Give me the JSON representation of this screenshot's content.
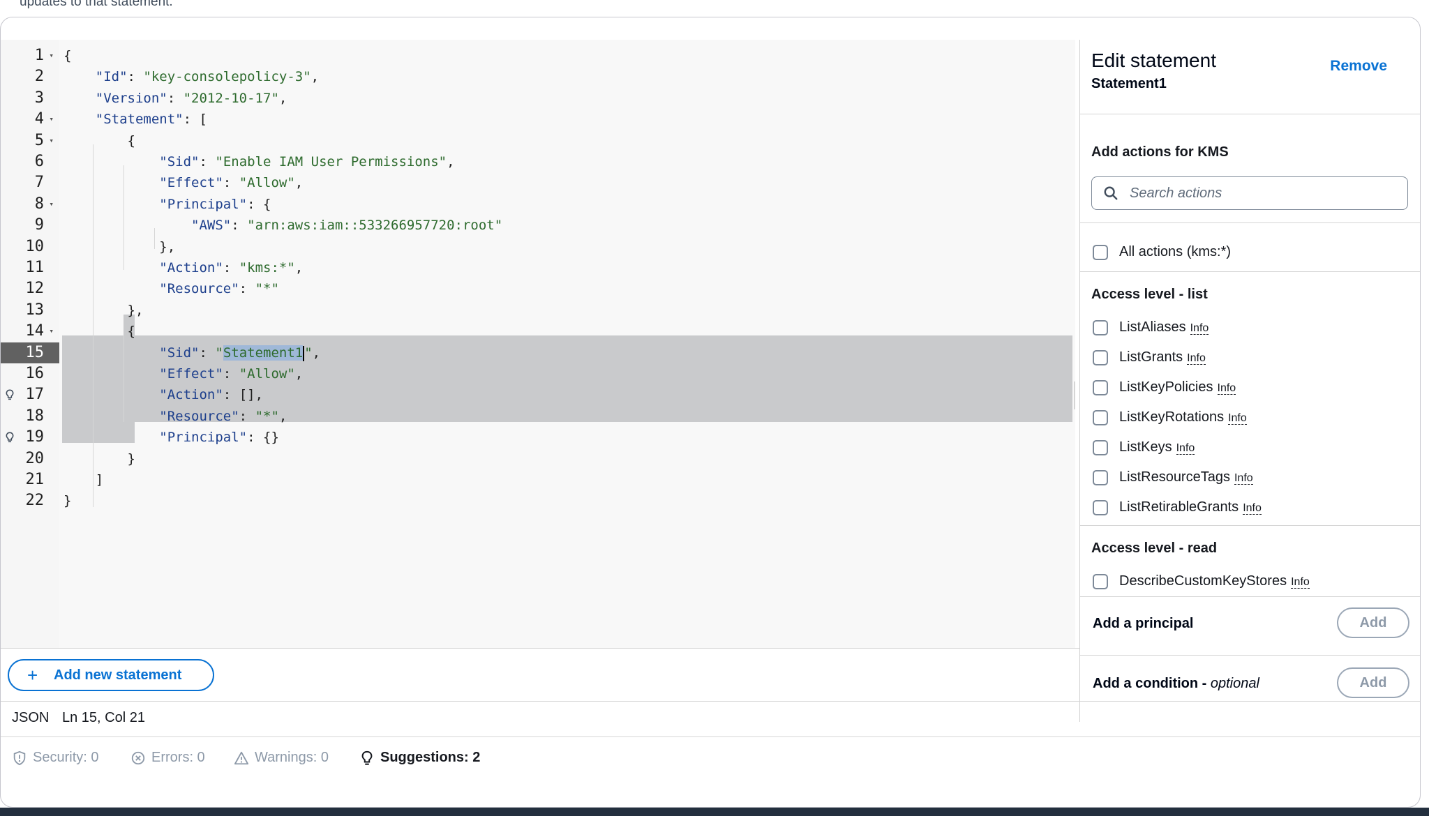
{
  "top_text": "updates to that statement.",
  "editor": {
    "lines": [
      {
        "n": "1",
        "fold": true,
        "parts": [
          {
            "t": "{",
            "c": "p"
          }
        ]
      },
      {
        "n": "2",
        "parts": [
          {
            "t": "    ",
            "c": "p"
          },
          {
            "t": "\"Id\"",
            "c": "k"
          },
          {
            "t": ": ",
            "c": "p"
          },
          {
            "t": "\"key-consolepolicy-3\"",
            "c": "s"
          },
          {
            "t": ",",
            "c": "p"
          }
        ]
      },
      {
        "n": "3",
        "parts": [
          {
            "t": "    ",
            "c": "p"
          },
          {
            "t": "\"Version\"",
            "c": "k"
          },
          {
            "t": ": ",
            "c": "p"
          },
          {
            "t": "\"2012-10-17\"",
            "c": "s"
          },
          {
            "t": ",",
            "c": "p"
          }
        ]
      },
      {
        "n": "4",
        "fold": true,
        "parts": [
          {
            "t": "    ",
            "c": "p"
          },
          {
            "t": "\"Statement\"",
            "c": "k"
          },
          {
            "t": ": [",
            "c": "p"
          }
        ]
      },
      {
        "n": "5",
        "fold": true,
        "parts": [
          {
            "t": "        {",
            "c": "p"
          }
        ]
      },
      {
        "n": "6",
        "parts": [
          {
            "t": "            ",
            "c": "p"
          },
          {
            "t": "\"Sid\"",
            "c": "k"
          },
          {
            "t": ": ",
            "c": "p"
          },
          {
            "t": "\"Enable IAM User Permissions\"",
            "c": "s"
          },
          {
            "t": ",",
            "c": "p"
          }
        ]
      },
      {
        "n": "7",
        "parts": [
          {
            "t": "            ",
            "c": "p"
          },
          {
            "t": "\"Effect\"",
            "c": "k"
          },
          {
            "t": ": ",
            "c": "p"
          },
          {
            "t": "\"Allow\"",
            "c": "s"
          },
          {
            "t": ",",
            "c": "p"
          }
        ]
      },
      {
        "n": "8",
        "fold": true,
        "parts": [
          {
            "t": "            ",
            "c": "p"
          },
          {
            "t": "\"Principal\"",
            "c": "k"
          },
          {
            "t": ": {",
            "c": "p"
          }
        ]
      },
      {
        "n": "9",
        "parts": [
          {
            "t": "                ",
            "c": "p"
          },
          {
            "t": "\"AWS\"",
            "c": "k"
          },
          {
            "t": ": ",
            "c": "p"
          },
          {
            "t": "\"arn:aws:iam::533266957720:root\"",
            "c": "s"
          }
        ]
      },
      {
        "n": "10",
        "parts": [
          {
            "t": "            },",
            "c": "p"
          }
        ]
      },
      {
        "n": "11",
        "parts": [
          {
            "t": "            ",
            "c": "p"
          },
          {
            "t": "\"Action\"",
            "c": "k"
          },
          {
            "t": ": ",
            "c": "p"
          },
          {
            "t": "\"kms:*\"",
            "c": "s"
          },
          {
            "t": ",",
            "c": "p"
          }
        ]
      },
      {
        "n": "12",
        "parts": [
          {
            "t": "            ",
            "c": "p"
          },
          {
            "t": "\"Resource\"",
            "c": "k"
          },
          {
            "t": ": ",
            "c": "p"
          },
          {
            "t": "\"*\"",
            "c": "s"
          }
        ]
      },
      {
        "n": "13",
        "parts": [
          {
            "t": "        },",
            "c": "p"
          }
        ]
      },
      {
        "n": "14",
        "fold": true,
        "parts": [
          {
            "t": "        {",
            "c": "p"
          }
        ]
      },
      {
        "n": "15",
        "active": true,
        "parts": [
          {
            "t": "            ",
            "c": "p"
          },
          {
            "t": "\"Sid\"",
            "c": "k"
          },
          {
            "t": ": ",
            "c": "p"
          },
          {
            "t": "\"",
            "c": "s"
          },
          {
            "t": "Statement1",
            "c": "s",
            "sel": true
          },
          {
            "t": "\"",
            "c": "s",
            "caret": true
          },
          {
            "t": ",",
            "c": "p"
          }
        ]
      },
      {
        "n": "16",
        "parts": [
          {
            "t": "            ",
            "c": "p"
          },
          {
            "t": "\"Effect\"",
            "c": "k"
          },
          {
            "t": ": ",
            "c": "p"
          },
          {
            "t": "\"Allow\"",
            "c": "s"
          },
          {
            "t": ",",
            "c": "p"
          }
        ]
      },
      {
        "n": "17",
        "bulb": true,
        "parts": [
          {
            "t": "            ",
            "c": "p"
          },
          {
            "t": "\"Action\"",
            "c": "k"
          },
          {
            "t": ": ",
            "c": "p"
          },
          {
            "t": "[]",
            "c": "p"
          },
          {
            "t": ",",
            "c": "p"
          }
        ]
      },
      {
        "n": "18",
        "parts": [
          {
            "t": "            ",
            "c": "p"
          },
          {
            "t": "\"Resource\"",
            "c": "k"
          },
          {
            "t": ": ",
            "c": "p"
          },
          {
            "t": "\"*\"",
            "c": "s"
          },
          {
            "t": ",",
            "c": "p"
          }
        ]
      },
      {
        "n": "19",
        "bulb": true,
        "parts": [
          {
            "t": "            ",
            "c": "p"
          },
          {
            "t": "\"Principal\"",
            "c": "k"
          },
          {
            "t": ": ",
            "c": "p"
          },
          {
            "t": "{}",
            "c": "p"
          }
        ]
      },
      {
        "n": "20",
        "parts": [
          {
            "t": "        }",
            "c": "p"
          }
        ]
      },
      {
        "n": "21",
        "parts": [
          {
            "t": "    ]",
            "c": "p"
          }
        ]
      },
      {
        "n": "22",
        "parts": [
          {
            "t": "}",
            "c": "p"
          }
        ]
      }
    ]
  },
  "side": {
    "title": "Edit statement",
    "subtitle": "Statement1",
    "remove": "Remove",
    "actions_title": "Add actions for KMS",
    "search_placeholder": "Search actions",
    "all_actions": "All actions (kms:*)",
    "group_list": "Access level - list",
    "list_actions": [
      "ListAliases",
      "ListGrants",
      "ListKeyPolicies",
      "ListKeyRotations",
      "ListKeys",
      "ListResourceTags",
      "ListRetirableGrants"
    ],
    "info": "Info",
    "group_read": "Access level - read",
    "read_actions": [
      "DescribeCustomKeyStores"
    ],
    "principal_label": "Add a principal",
    "condition_label": "Add a condition - ",
    "condition_optional": "optional",
    "add": "Add"
  },
  "footer": {
    "add_statement": "Add new statement",
    "mode": "JSON",
    "position": "Ln 15, Col 21",
    "security": "Security: 0",
    "errors": "Errors: 0",
    "warnings": "Warnings: 0",
    "suggestions": "Suggestions: 2"
  },
  "colors": {
    "accent": "#0972d3",
    "selection": "#c9cacc",
    "key": "#1d3f8c",
    "string": "#2e6b2e"
  }
}
